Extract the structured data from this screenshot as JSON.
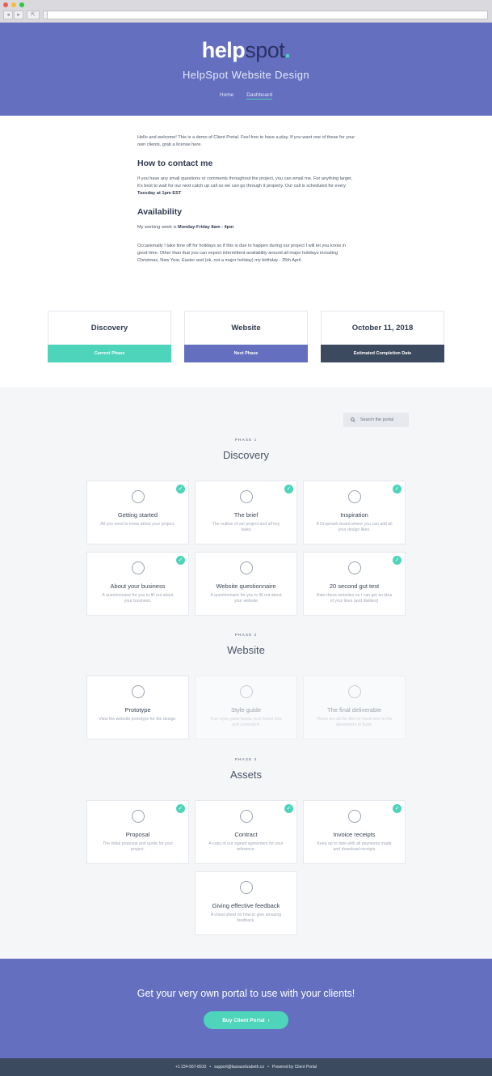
{
  "hero": {
    "logo_part1": "help",
    "logo_part2": "spot",
    "logo_dot": ".",
    "title": "HelpSpot Website Design",
    "nav": [
      "Home",
      "Dashboard"
    ]
  },
  "intro": {
    "welcome": "Hello and welcome! This is a demo of Client Portal. Feel free to have a play. If you want one of these for your own clients, grab a license here.",
    "contact_heading": "How to contact me",
    "contact_text": "If you have any small questions or comments throughout the project, you can email me. For anything larger, it's best to wait for our next catch up call so we can go through it properly. Our call is scheduled for every ",
    "contact_bold": "Tuesday at 1pm EST",
    "availability_heading": "Availability",
    "availability_text": "My working week is ",
    "availability_bold": "Monday-Friday 8am - 4pm",
    "holiday_text": "Occasionally I take time off for holidays so if this is due to happen during our project I will let you know in good time. Other than that you can expect intermittent availability around all major holidays including Christmas, New Year, Easter and (ok, not a major holiday) my birthday - 25th April."
  },
  "stats": [
    {
      "value": "Discovery",
      "label": "Current Phase",
      "color": "#4dd4bb"
    },
    {
      "value": "Website",
      "label": "Next Phase",
      "color": "#6470bf"
    },
    {
      "value": "October 11, 2018",
      "label": "Estimated Completion Date",
      "color": "#3b4a5e"
    }
  ],
  "search": {
    "placeholder": "Search the portal",
    "icon": "search-icon"
  },
  "phases": [
    {
      "label": "PHASE 1",
      "title": "Discovery",
      "cards": [
        {
          "title": "Getting started",
          "desc": "All you need to know about your project.",
          "done": true
        },
        {
          "title": "The brief",
          "desc": "The outline of our project and all key tasks",
          "done": true
        },
        {
          "title": "Inspiration",
          "desc": "A Dropmark board where you can add all your design likes.",
          "done": true
        },
        {
          "title": "About your business",
          "desc": "A questionnaire for you to fill out about your business.",
          "done": true
        },
        {
          "title": "Website questionnaire",
          "desc": "A questionnaire for you to fill out about your website",
          "done": false
        },
        {
          "title": "20 second gut test",
          "desc": "Rate these websites so I can get an idea of your likes (and dislikes)",
          "done": true
        }
      ]
    },
    {
      "label": "PHASE 2",
      "title": "Website",
      "cards": [
        {
          "title": "Prototype",
          "desc": "View the website prototype for the design.",
          "done": false,
          "dim": false
        },
        {
          "title": "Style guide",
          "desc": "Your style guide keeps your brand nice and consistent.",
          "done": false,
          "dim": true
        },
        {
          "title": "The final deliverable",
          "desc": "These are all the files to hand over to the developers to build.",
          "done": false,
          "dim": true
        }
      ]
    },
    {
      "label": "PHASE 3",
      "title": "Assets",
      "cards": [
        {
          "title": "Proposal",
          "desc": "The initial proposal and quote for your project.",
          "done": true
        },
        {
          "title": "Contract",
          "desc": "A copy of our signed agreement for your reference.",
          "done": true
        },
        {
          "title": "Invoice receipts",
          "desc": "Keep up to date with all payments made and download receipts",
          "done": true
        },
        {
          "title": "Giving effective feedback",
          "desc": "A cheat sheet on how to give amazing feedback.",
          "done": false
        }
      ]
    }
  ],
  "cta": {
    "title": "Get your very own portal to use with your clients!",
    "button": "Buy Client Portal",
    "button_icon": "›"
  },
  "footer": {
    "phone": "+1 234-567-8910",
    "email": "support@laurazelizabeth.co",
    "powered": "Powered by Client Portal",
    "sep": "•"
  }
}
